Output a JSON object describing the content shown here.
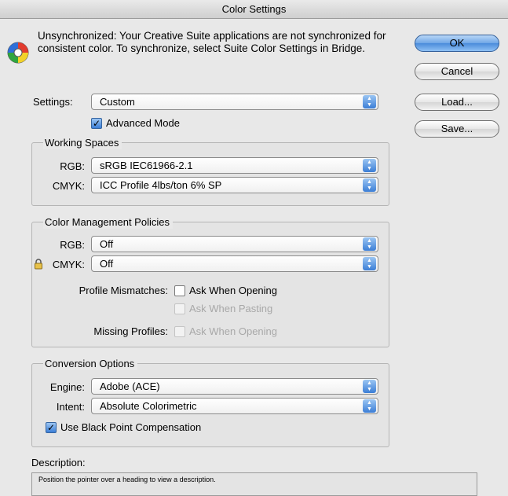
{
  "window": {
    "title": "Color Settings"
  },
  "warning": {
    "icon": "color-wheel-icon",
    "text": "Unsynchronized: Your Creative Suite applications are not synchronized for consistent color. To synchronize, select Suite Color Settings in Bridge."
  },
  "buttons": {
    "ok": "OK",
    "cancel": "Cancel",
    "load": "Load...",
    "save": "Save..."
  },
  "settings": {
    "label": "Settings:",
    "value": "Custom",
    "advanced_mode_label": "Advanced Mode",
    "advanced_mode_checked": true
  },
  "working_spaces": {
    "title": "Working Spaces",
    "rgb_label": "RGB:",
    "rgb_value": "sRGB IEC61966-2.1",
    "cmyk_label": "CMYK:",
    "cmyk_value": "ICC Profile 4lbs/ton 6% SP"
  },
  "policies": {
    "title": "Color Management Policies",
    "rgb_label": "RGB:",
    "rgb_value": "Off",
    "cmyk_label": "CMYK:",
    "cmyk_value": "Off",
    "profile_mismatches_label": "Profile Mismatches:",
    "ask_when_opening": "Ask When Opening",
    "ask_when_pasting": "Ask When Pasting",
    "missing_profiles_label": "Missing Profiles:",
    "missing_ask_when_opening": "Ask When Opening"
  },
  "conversion": {
    "title": "Conversion Options",
    "engine_label": "Engine:",
    "engine_value": "Adobe (ACE)",
    "intent_label": "Intent:",
    "intent_value": "Absolute Colorimetric",
    "black_point_label": "Use Black Point Compensation",
    "black_point_checked": true
  },
  "description": {
    "label": "Description:",
    "text": "Position the pointer over a heading to view a description."
  }
}
